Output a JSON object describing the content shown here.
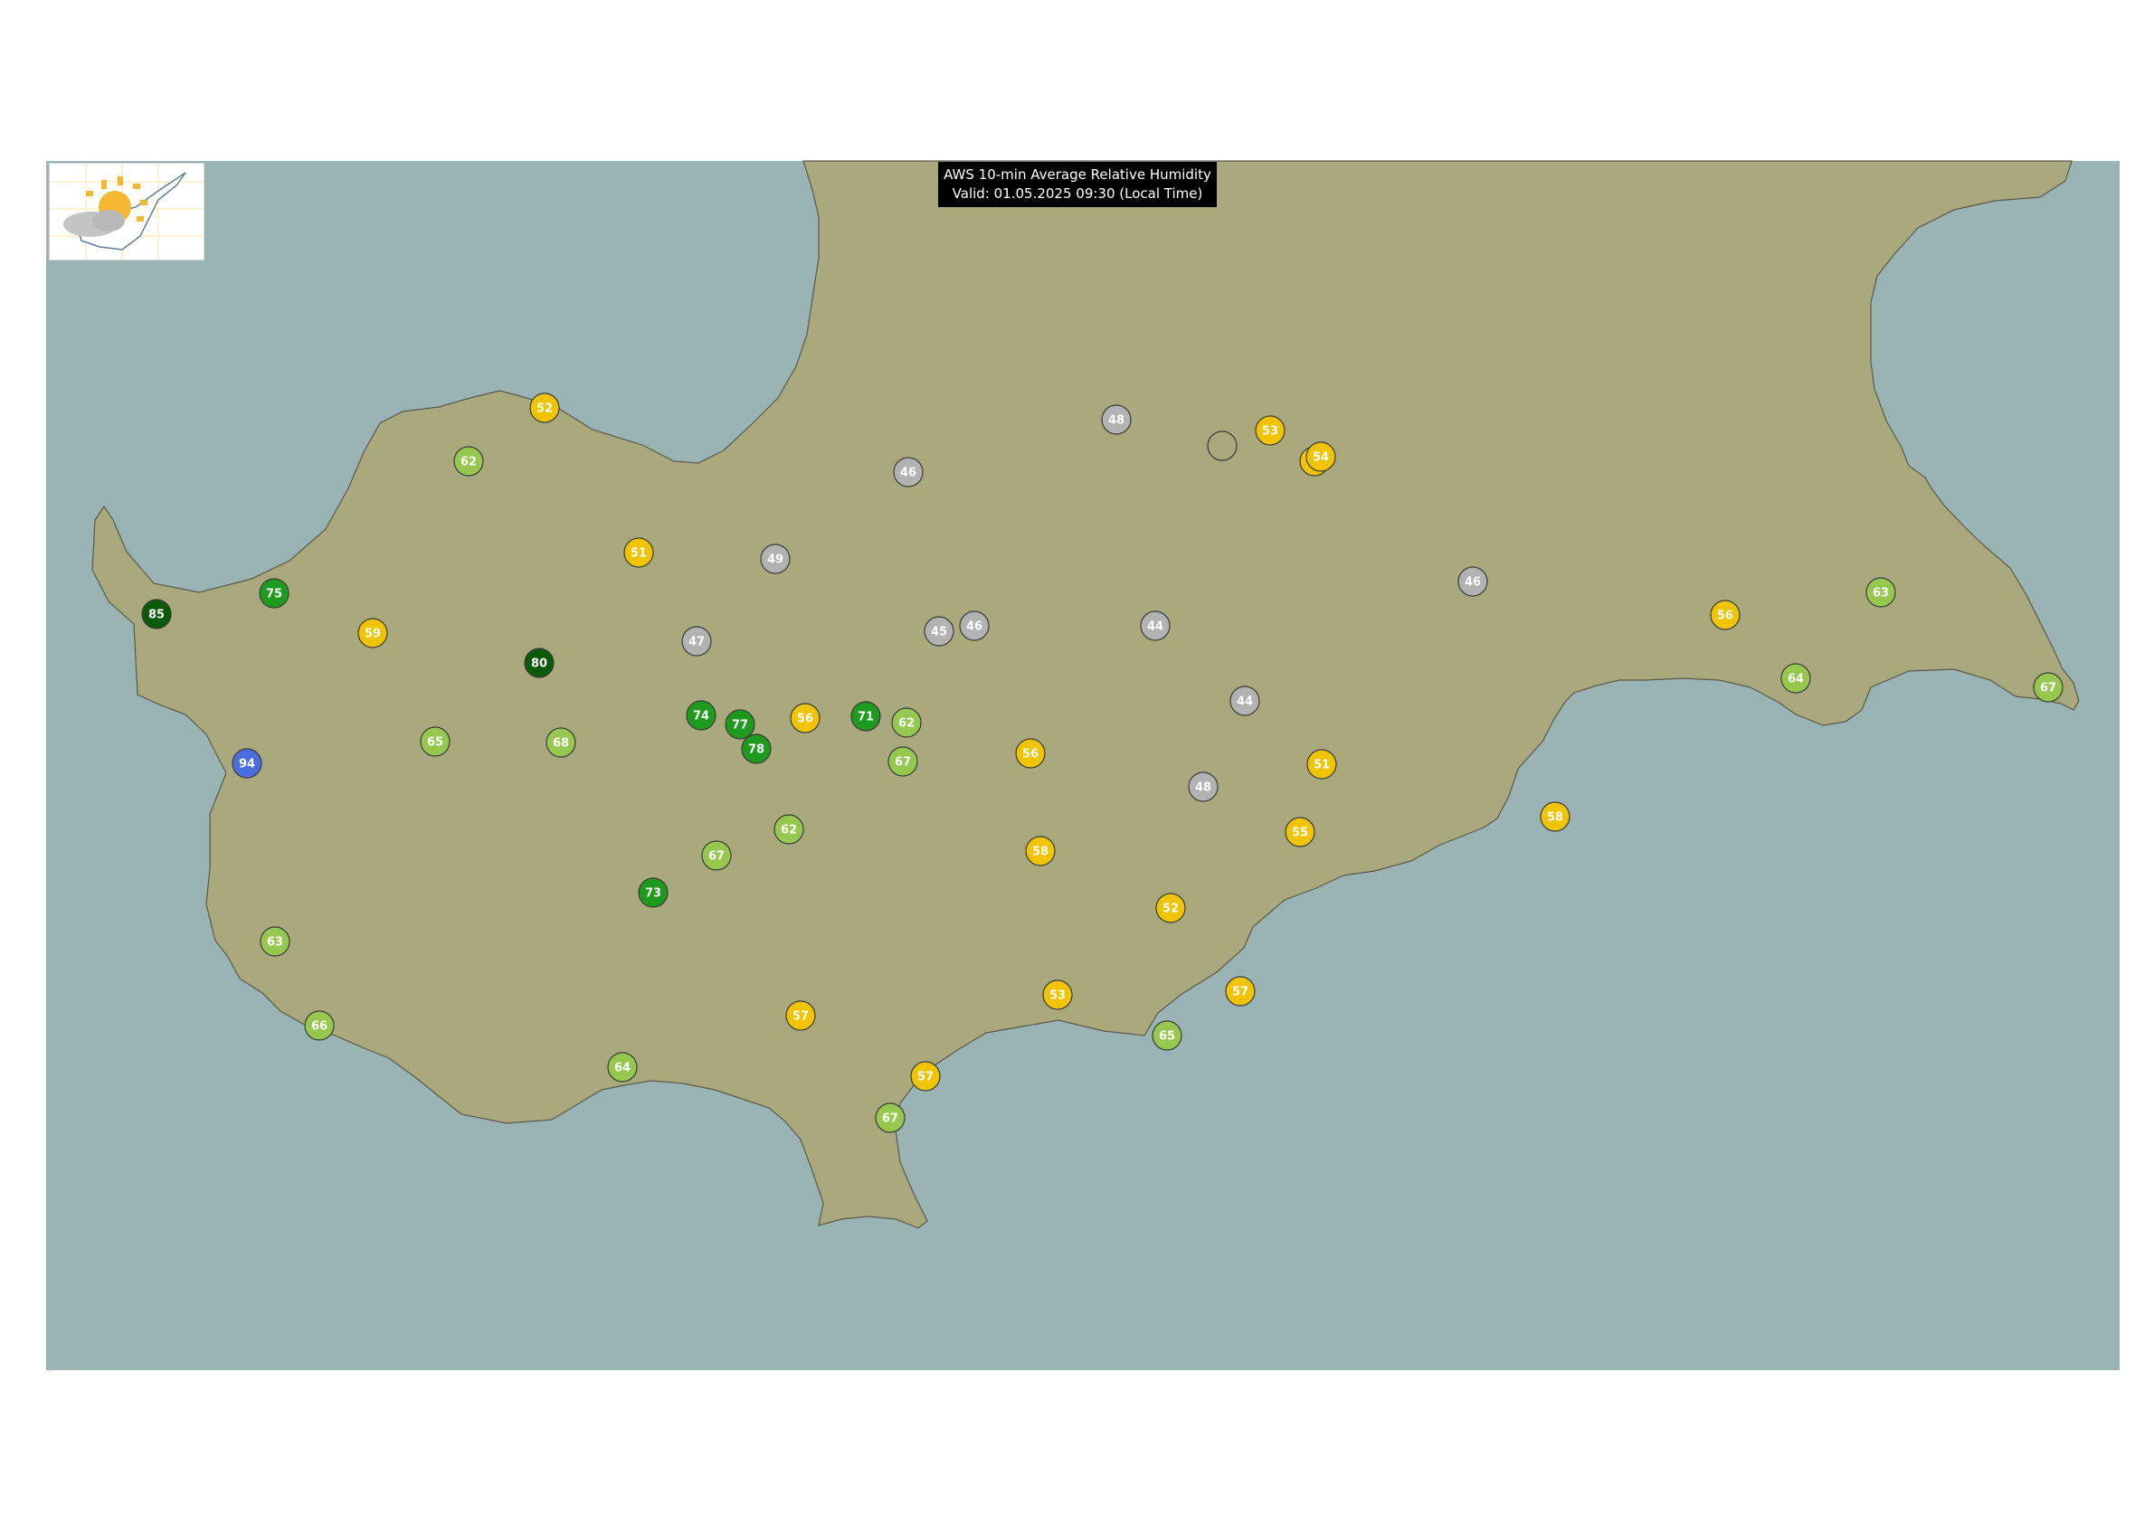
{
  "title": {
    "line1": "AWS 10-min Average Relative Humidity",
    "line2": "Valid: 01.05.2025 09:30 (Local Time)"
  },
  "logo": {
    "icon": "weather-logo-sun-cloud-cyprus"
  },
  "colors": {
    "sea": "#9ab3b4",
    "land": "#a9a97d",
    "coast": "#5a5a4a",
    "class_gray": "#b2b2b2",
    "class_yellow": "#f0c400",
    "class_lightgreen": "#96c850",
    "class_green": "#1e9b1e",
    "class_darkgreen": "#0a5a0a",
    "class_blue": "#4a6ee0"
  },
  "stations": [
    {
      "value": "52",
      "class": "yellow"
    },
    {
      "value": "62",
      "class": "lightgreen"
    },
    {
      "value": "48",
      "class": "gray"
    },
    {
      "value": "",
      "class": "empty"
    },
    {
      "value": "53",
      "class": "yellow"
    },
    {
      "value": "",
      "class": "yellow"
    },
    {
      "value": "54",
      "class": "yellow"
    },
    {
      "value": "46",
      "class": "gray"
    },
    {
      "value": "51",
      "class": "yellow"
    },
    {
      "value": "49",
      "class": "gray"
    },
    {
      "value": "75",
      "class": "green"
    },
    {
      "value": "85",
      "class": "darkgreen"
    },
    {
      "value": "59",
      "class": "yellow"
    },
    {
      "value": "47",
      "class": "gray"
    },
    {
      "value": "45",
      "class": "gray"
    },
    {
      "value": "46",
      "class": "gray"
    },
    {
      "value": "44",
      "class": "gray"
    },
    {
      "value": "46",
      "class": "gray"
    },
    {
      "value": "56",
      "class": "yellow"
    },
    {
      "value": "63",
      "class": "lightgreen"
    },
    {
      "value": "80",
      "class": "darkgreen"
    },
    {
      "value": "64",
      "class": "lightgreen"
    },
    {
      "value": "67",
      "class": "lightgreen"
    },
    {
      "value": "74",
      "class": "green"
    },
    {
      "value": "77",
      "class": "green"
    },
    {
      "value": "56",
      "class": "yellow"
    },
    {
      "value": "71",
      "class": "green"
    },
    {
      "value": "62",
      "class": "lightgreen"
    },
    {
      "value": "44",
      "class": "gray"
    },
    {
      "value": "78",
      "class": "green"
    },
    {
      "value": "94",
      "class": "blue"
    },
    {
      "value": "65",
      "class": "lightgreen"
    },
    {
      "value": "68",
      "class": "lightgreen"
    },
    {
      "value": "67",
      "class": "lightgreen"
    },
    {
      "value": "56",
      "class": "yellow"
    },
    {
      "value": "51",
      "class": "yellow"
    },
    {
      "value": "48",
      "class": "gray"
    },
    {
      "value": "62",
      "class": "lightgreen"
    },
    {
      "value": "55",
      "class": "yellow"
    },
    {
      "value": "58",
      "class": "yellow"
    },
    {
      "value": "67",
      "class": "lightgreen"
    },
    {
      "value": "58",
      "class": "yellow"
    },
    {
      "value": "73",
      "class": "green"
    },
    {
      "value": "52",
      "class": "yellow"
    },
    {
      "value": "63",
      "class": "lightgreen"
    },
    {
      "value": "53",
      "class": "yellow"
    },
    {
      "value": "57",
      "class": "yellow"
    },
    {
      "value": "57",
      "class": "yellow"
    },
    {
      "value": "66",
      "class": "lightgreen"
    },
    {
      "value": "65",
      "class": "lightgreen"
    },
    {
      "value": "64",
      "class": "lightgreen"
    },
    {
      "value": "57",
      "class": "yellow"
    },
    {
      "value": "67",
      "class": "lightgreen"
    }
  ]
}
